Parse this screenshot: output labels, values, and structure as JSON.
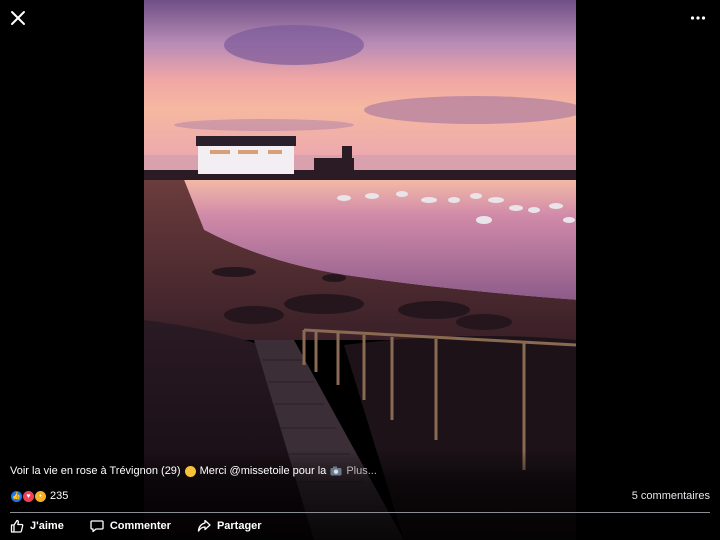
{
  "viewer": {
    "close_icon": "close-icon",
    "more_icon": "more-horizontal-icon"
  },
  "post": {
    "caption_text": "Voir la vie en rose à Trévignon (29)",
    "caption_text_2": "Merci @missetoile pour la",
    "more_label": "Plus...",
    "reaction_count": "235",
    "comments_label": "5 commentaires"
  },
  "actions": {
    "like_label": "J'aime",
    "comment_label": "Commenter",
    "share_label": "Partager"
  },
  "colors": {
    "like_blue": "#1877f2",
    "love_red": "#f33e58",
    "wow_yellow": "#f7b125"
  }
}
